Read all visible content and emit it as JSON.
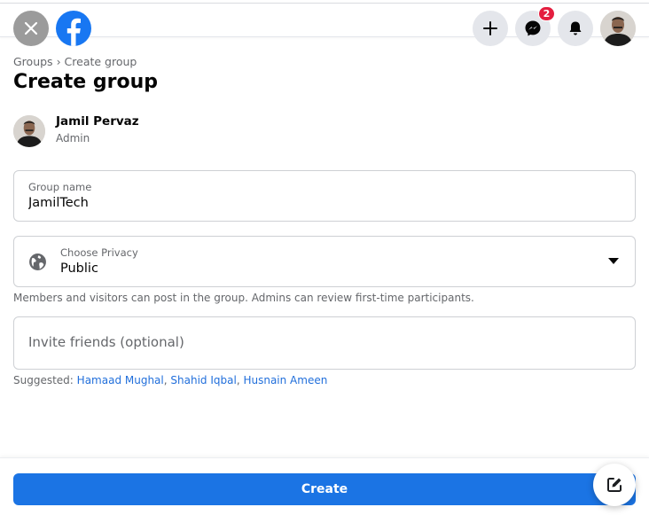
{
  "header": {
    "close_icon": "close-icon",
    "logo": "facebook-logo",
    "actions": [
      {
        "name": "create",
        "icon": "plus-icon"
      },
      {
        "name": "messenger",
        "icon": "messenger-icon",
        "badge": "2"
      },
      {
        "name": "notifications",
        "icon": "bell-icon"
      },
      {
        "name": "account",
        "icon": "avatar"
      }
    ],
    "messenger_badge": "2"
  },
  "breadcrumb": {
    "parent": "Groups",
    "separator": "›",
    "current": "Create group"
  },
  "page_title": "Create group",
  "owner": {
    "name": "Jamil Pervaz",
    "role": "Admin"
  },
  "form": {
    "group_name": {
      "label": "Group name",
      "value": "JamilTech"
    },
    "privacy": {
      "label": "Choose Privacy",
      "value": "Public",
      "icon": "globe-icon",
      "helper": "Members and visitors can post in the group. Admins can review first-time participants."
    },
    "invite": {
      "placeholder": "Invite friends (optional)",
      "value": ""
    },
    "suggested": {
      "label": "Suggested:",
      "people": [
        "Hamaad Mughal",
        "Shahid Iqbal",
        "Husnain Ameen"
      ]
    }
  },
  "footer": {
    "create_label": "Create",
    "compose_icon": "compose-icon"
  },
  "colors": {
    "primary": "#1b74e4",
    "link": "#216fdb",
    "badge": "#e41e3f",
    "secondary_text": "#65676b"
  }
}
